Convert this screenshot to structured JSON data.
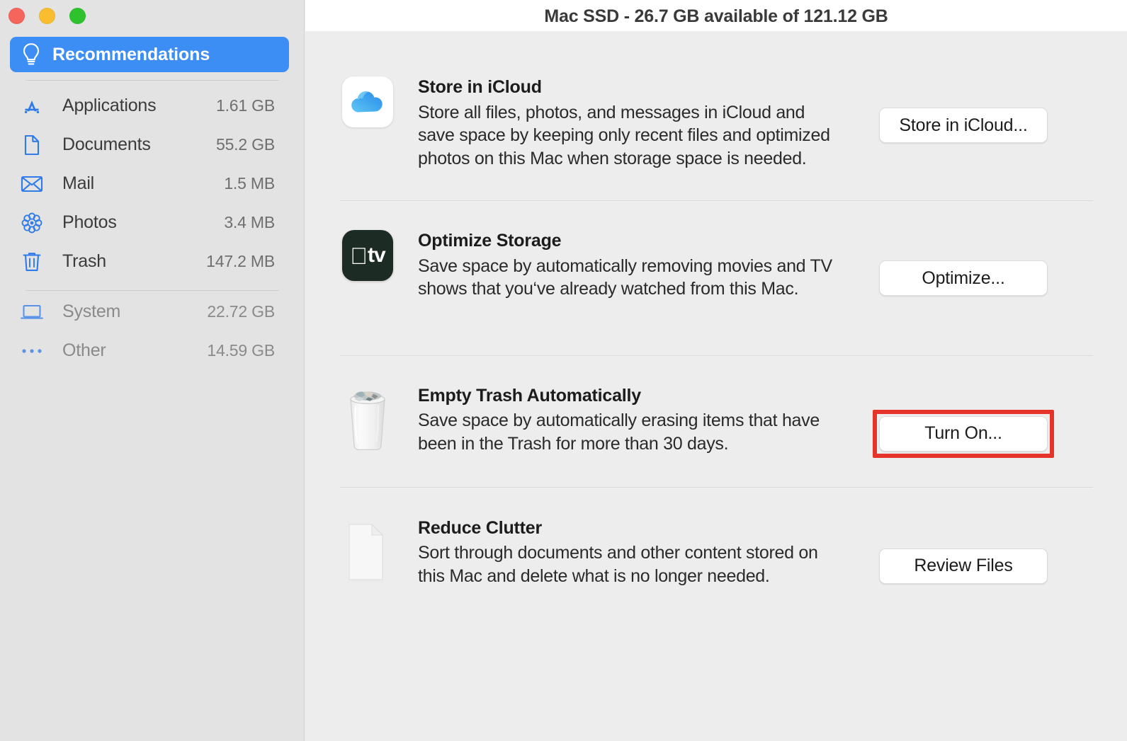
{
  "window": {
    "title": "Mac SSD - 26.7 GB available of 121.12 GB",
    "traffic_lights": {
      "close": "close-button",
      "minimize": "minimize-button",
      "zoom": "zoom-button"
    }
  },
  "sidebar": {
    "selected": {
      "label": "Recommendations",
      "icon": "lightbulb-icon",
      "accent_color": "#3c8ef5"
    },
    "items": [
      {
        "label": "Applications",
        "size": "1.61 GB",
        "icon": "app-store-icon",
        "dim": false
      },
      {
        "label": "Documents",
        "size": "55.2 GB",
        "icon": "document-icon",
        "dim": false
      },
      {
        "label": "Mail",
        "size": "1.5 MB",
        "icon": "mail-icon",
        "dim": false
      },
      {
        "label": "Photos",
        "size": "3.4 MB",
        "icon": "photos-icon",
        "dim": false
      },
      {
        "label": "Trash",
        "size": "147.2 MB",
        "icon": "trash-icon",
        "dim": false
      }
    ],
    "system_items": [
      {
        "label": "System",
        "size": "22.72 GB",
        "icon": "laptop-icon",
        "dim": true
      },
      {
        "label": "Other",
        "size": "14.59 GB",
        "icon": "ellipsis-icon",
        "dim": true
      }
    ]
  },
  "main": {
    "rows": [
      {
        "title": "Store in iCloud",
        "description": "Store all files, photos, and messages in iCloud and save space by keeping only recent files and optimized photos on this Mac when storage space is needed.",
        "icon": "icloud-icon",
        "button": "Store in iCloud...",
        "highlighted": false
      },
      {
        "title": "Optimize Storage",
        "description": "Save space by automatically removing movies and TV shows that you‘ve already watched from this Mac.",
        "icon": "apple-tv-icon",
        "button": "Optimize...",
        "highlighted": false
      },
      {
        "title": "Empty Trash Automatically",
        "description": "Save space by automatically erasing items that have been in the Trash for more than 30 days.",
        "icon": "trash-full-icon",
        "button": "Turn On...",
        "highlighted": true
      },
      {
        "title": "Reduce Clutter",
        "description": "Sort through documents and other content stored on this Mac and delete what is no longer needed.",
        "icon": "document-page-icon",
        "button": "Review Files",
        "highlighted": false
      }
    ],
    "highlight_color": "#e5342a"
  }
}
